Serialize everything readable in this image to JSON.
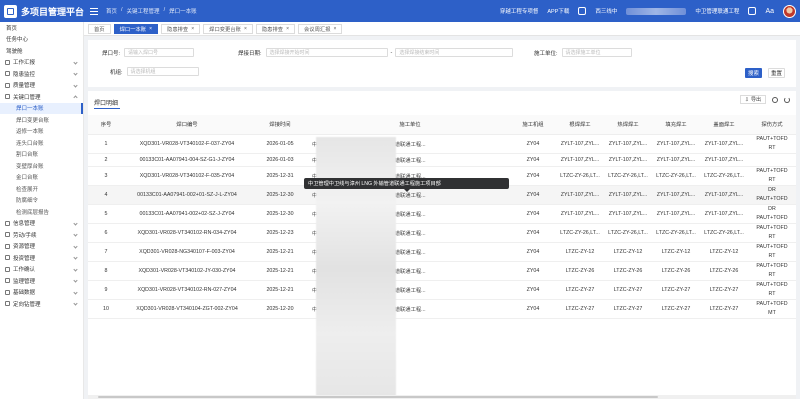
{
  "header": {
    "app_title": "多项目管理平台",
    "breadcrumbs": [
      "首页",
      "/",
      "关键工程管理",
      "/",
      "焊口一本账"
    ],
    "links": [
      "穿越工程专项督",
      "APP下载"
    ],
    "user_name": "西三线中",
    "project": "中卫管理联通工程"
  },
  "tabs": [
    {
      "label": "首页",
      "active": false
    },
    {
      "label": "焊口一本账",
      "active": true
    },
    {
      "label": "隐患排查",
      "active": false
    },
    {
      "label": "焊口变更台账",
      "active": false
    },
    {
      "label": "隐患排查",
      "active": false
    },
    {
      "label": "会议周汇报",
      "active": false
    }
  ],
  "sidebar": {
    "items": [
      {
        "label": "首页",
        "kind": "top"
      },
      {
        "label": "任务中心",
        "kind": "top"
      },
      {
        "label": "驾驶舱",
        "kind": "top"
      },
      {
        "label": "工作汇报",
        "kind": "group"
      },
      {
        "label": "隐患监控",
        "kind": "group"
      },
      {
        "label": "质量管理",
        "kind": "group"
      },
      {
        "label": "关键口管理",
        "kind": "group-open"
      },
      {
        "label": "焊口一本账",
        "kind": "sub-active"
      },
      {
        "label": "焊口变更台账",
        "kind": "sub"
      },
      {
        "label": "返修一本账",
        "kind": "sub"
      },
      {
        "label": "连头口台账",
        "kind": "sub"
      },
      {
        "label": "割口台账",
        "kind": "sub"
      },
      {
        "label": "变壁厚台账",
        "kind": "sub"
      },
      {
        "label": "金口台账",
        "kind": "sub"
      },
      {
        "label": "检查展开",
        "kind": "sub"
      },
      {
        "label": "防腐细令",
        "kind": "sub"
      },
      {
        "label": "检测底层报告",
        "kind": "sub"
      },
      {
        "label": "信息管理",
        "kind": "group"
      },
      {
        "label": "劳动/手续",
        "kind": "group"
      },
      {
        "label": "资源管理",
        "kind": "group"
      },
      {
        "label": "投资管理",
        "kind": "group"
      },
      {
        "label": "工作确认",
        "kind": "group"
      },
      {
        "label": "监理管理",
        "kind": "group"
      },
      {
        "label": "基础数据",
        "kind": "group"
      },
      {
        "label": "定向钻管理",
        "kind": "group"
      }
    ]
  },
  "search": {
    "weld_no_label": "焊口号:",
    "weld_no_placeholder": "请输入焊口号",
    "date_label": "焊接日期:",
    "date_start_placeholder": "选择焊接开始时间",
    "date_sep": "-",
    "date_end_placeholder": "选择焊接结束时间",
    "unit_label": "施工单位:",
    "unit_placeholder": "请选择施工单位",
    "crew_label": "机组:",
    "crew_placeholder": "请选择机组",
    "search_button": "搜索",
    "reset_button": "重置"
  },
  "table": {
    "title": "焊口明细",
    "export_label": "导出",
    "columns": [
      "序号",
      "焊口编号",
      "焊接时间",
      "施工单位",
      "施工机组",
      "根焊焊工",
      "热焊焊工",
      "填充焊工",
      "盖面焊工",
      "探伤方式"
    ],
    "tooltip": "中卫管理中卫线与漳州 LNG 外输管道联通工程施工项目部",
    "rows": [
      {
        "no": "1",
        "weld_no": "XQD301-VR028-VT340102-F-037-ZY04",
        "time": "2026-01-05",
        "unit": "中卫管理中卫线与漳州 LNG 外输管道联通工程...",
        "crew": "ZY04",
        "root": "ZYLT-107,ZYL...",
        "hot": "ZYLT-107,ZYL...",
        "fill": "ZYLT-107,ZYL...",
        "cap": "ZYLT-107,ZYL...",
        "ndt": "PAUT+TOFD\nRT",
        "h": "r3",
        "hl": false
      },
      {
        "no": "2",
        "weld_no": "00133C01-AA07941-004-SZ-G1-J-ZY04",
        "time": "2026-01-03",
        "unit": "中卫管理中卫线与漳州 LNG 外输管道联通工程...",
        "crew": "ZY04",
        "root": "ZYLT-107,ZYL...",
        "hot": "ZYLT-107,ZYL...",
        "fill": "ZYLT-107,ZYL...",
        "cap": "ZYLT-107,ZYL...",
        "ndt": "",
        "h": "r2",
        "hl": false
      },
      {
        "no": "3",
        "weld_no": "XQD301-VR028-VT340102-F-035-ZY04",
        "time": "2025-12-31",
        "unit": "中卫管理中卫线与漳州 LNG 外输管道联通工程...",
        "crew": "ZY04",
        "root": "LTZC-ZY-26,LT...",
        "hot": "LTZC-ZY-26,LT...",
        "fill": "LTZC-ZY-26,LT...",
        "cap": "LTZC-ZY-26,LT...",
        "ndt": "PAUT+TOFD\nRT",
        "h": "r3",
        "hl": false
      },
      {
        "no": "4",
        "weld_no": "00133C01-AA07941-002+01-SZ-J-L-ZY04",
        "time": "2025-12-30",
        "unit": "中卫管理中卫线与漳州 LNG 外输管道联通工程...",
        "crew": "ZY04",
        "root": "ZYLT-107,ZYL...",
        "hot": "ZYLT-107,ZYL...",
        "fill": "ZYLT-107,ZYL...",
        "cap": "ZYLT-107,ZYL...",
        "ndt": "DR\nPAUT+TOFD",
        "h": "r3",
        "hl": true
      },
      {
        "no": "5",
        "weld_no": "00133C01-AA07941-002+02-SZ-J-ZY04",
        "time": "2025-12-30",
        "unit": "中卫管理中卫线与漳州 LNG 外输管道联通工程...",
        "crew": "ZY04",
        "root": "ZYLT-107,ZYL...",
        "hot": "ZYLT-107,ZYL...",
        "fill": "ZYLT-107,ZYL...",
        "cap": "ZYLT-107,ZYL...",
        "ndt": "DR\nPAUT+TOFD",
        "h": "r3",
        "hl": false
      },
      {
        "no": "6",
        "weld_no": "XQD301-VR028-VT340102-RN-034-ZY04",
        "time": "2025-12-23",
        "unit": "中卫管理中卫线与漳州 LNG 外输管道联通工程...",
        "crew": "ZY04",
        "root": "LTZC-ZY-26,LT...",
        "hot": "LTZC-ZY-26,LT...",
        "fill": "LTZC-ZY-26,LT...",
        "cap": "LTZC-ZY-26,LT...",
        "ndt": "PAUT+TOFD\nRT",
        "h": "r3",
        "hl": false
      },
      {
        "no": "7",
        "weld_no": "XQD301-VR028-NG340107-F-003-ZY04",
        "time": "2025-12-21",
        "unit": "中卫管理中卫线与漳州 LNG 外输管道联通工程...",
        "crew": "ZY04",
        "root": "LTZC-ZY-12",
        "hot": "LTZC-ZY-12",
        "fill": "LTZC-ZY-12",
        "cap": "LTZC-ZY-12",
        "ndt": "PAUT+TOFD\nRT",
        "h": "r3",
        "hl": false
      },
      {
        "no": "8",
        "weld_no": "XQD301-VR028-VT340102-JY-030-ZY04",
        "time": "2025-12-21",
        "unit": "中卫管理中卫线与漳州 LNG 外输管道联通工程...",
        "crew": "ZY04",
        "root": "LTZC-ZY-26",
        "hot": "LTZC-ZY-26",
        "fill": "LTZC-ZY-26",
        "cap": "LTZC-ZY-26",
        "ndt": "PAUT+TOFD\nRT",
        "h": "r3",
        "hl": false
      },
      {
        "no": "9",
        "weld_no": "XQD301-VR028-VT340102-RN-027-ZY04",
        "time": "2025-12-21",
        "unit": "中卫管理中卫线与漳州 LNG 外输管道联通工程...",
        "crew": "ZY04",
        "root": "LTZC-ZY-27",
        "hot": "LTZC-ZY-27",
        "fill": "LTZC-ZY-27",
        "cap": "LTZC-ZY-27",
        "ndt": "PAUT+TOFD\nRT",
        "h": "r3",
        "hl": false
      },
      {
        "no": "10",
        "weld_no": "XQD301-VR028-VT340104-ZGT-002-ZY04",
        "time": "2025-12-20",
        "unit": "中卫管理中卫线与漳州 LNG 外输管道联通工程...",
        "crew": "ZY04",
        "root": "LTZC-ZY-27",
        "hot": "LTZC-ZY-27",
        "fill": "LTZC-ZY-27",
        "cap": "LTZC-ZY-27",
        "ndt": "PAUT+TOFD\nMT",
        "h": "r3",
        "hl": false
      }
    ]
  }
}
